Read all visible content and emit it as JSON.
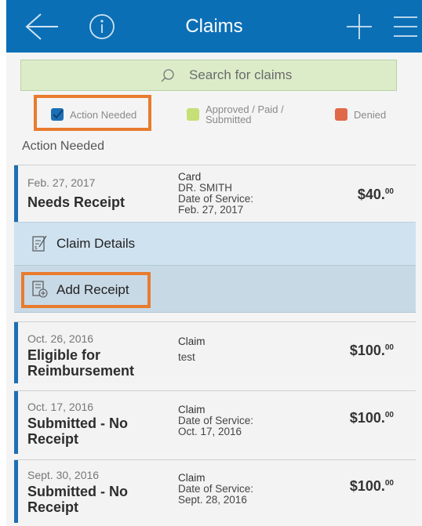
{
  "header": {
    "title": "Claims"
  },
  "search": {
    "placeholder": "Search for claims"
  },
  "legend": {
    "action_needed": "Action Needed",
    "approved": "Approved / Paid / Submitted",
    "approved_line1": "Approved / Paid /",
    "approved_line2": "Submitted",
    "denied": "Denied",
    "colors": {
      "action": "#1c6fb4",
      "approved": "#c6df77",
      "denied": "#e0694a",
      "highlight": "#e97b2e"
    }
  },
  "section_label": "Action Needed",
  "claims": [
    {
      "date": "Feb. 27, 2017",
      "status": "Needs Receipt",
      "type": "Card",
      "line2": "DR. SMITH",
      "line3": "Date of Service:",
      "line4": "Feb. 27, 2017",
      "amount": "$40.",
      "cents": "00"
    },
    {
      "date": "Oct. 26, 2016",
      "status": "Eligible for Reimbursement",
      "type": "Claim",
      "line2": "test",
      "amount": "$100.",
      "cents": "00"
    },
    {
      "date": "Oct. 17, 2016",
      "status": "Submitted - No Receipt",
      "type": "Claim",
      "line2": "Date of Service:",
      "line3": "Oct. 17, 2016",
      "amount": "$100.",
      "cents": "00"
    },
    {
      "date": "Sept. 30, 2016",
      "status": "Submitted - No Receipt",
      "type": "Claim",
      "line2": "Date of Service:",
      "line3": "Sept. 28, 2016",
      "amount": "$100.",
      "cents": "00"
    }
  ],
  "actions": {
    "claim_details": "Claim Details",
    "add_receipt": "Add Receipt"
  },
  "icons": [
    "back-arrow-icon",
    "info-icon",
    "plus-icon",
    "menu-icon",
    "search-icon",
    "claim-details-icon",
    "add-receipt-icon"
  ]
}
